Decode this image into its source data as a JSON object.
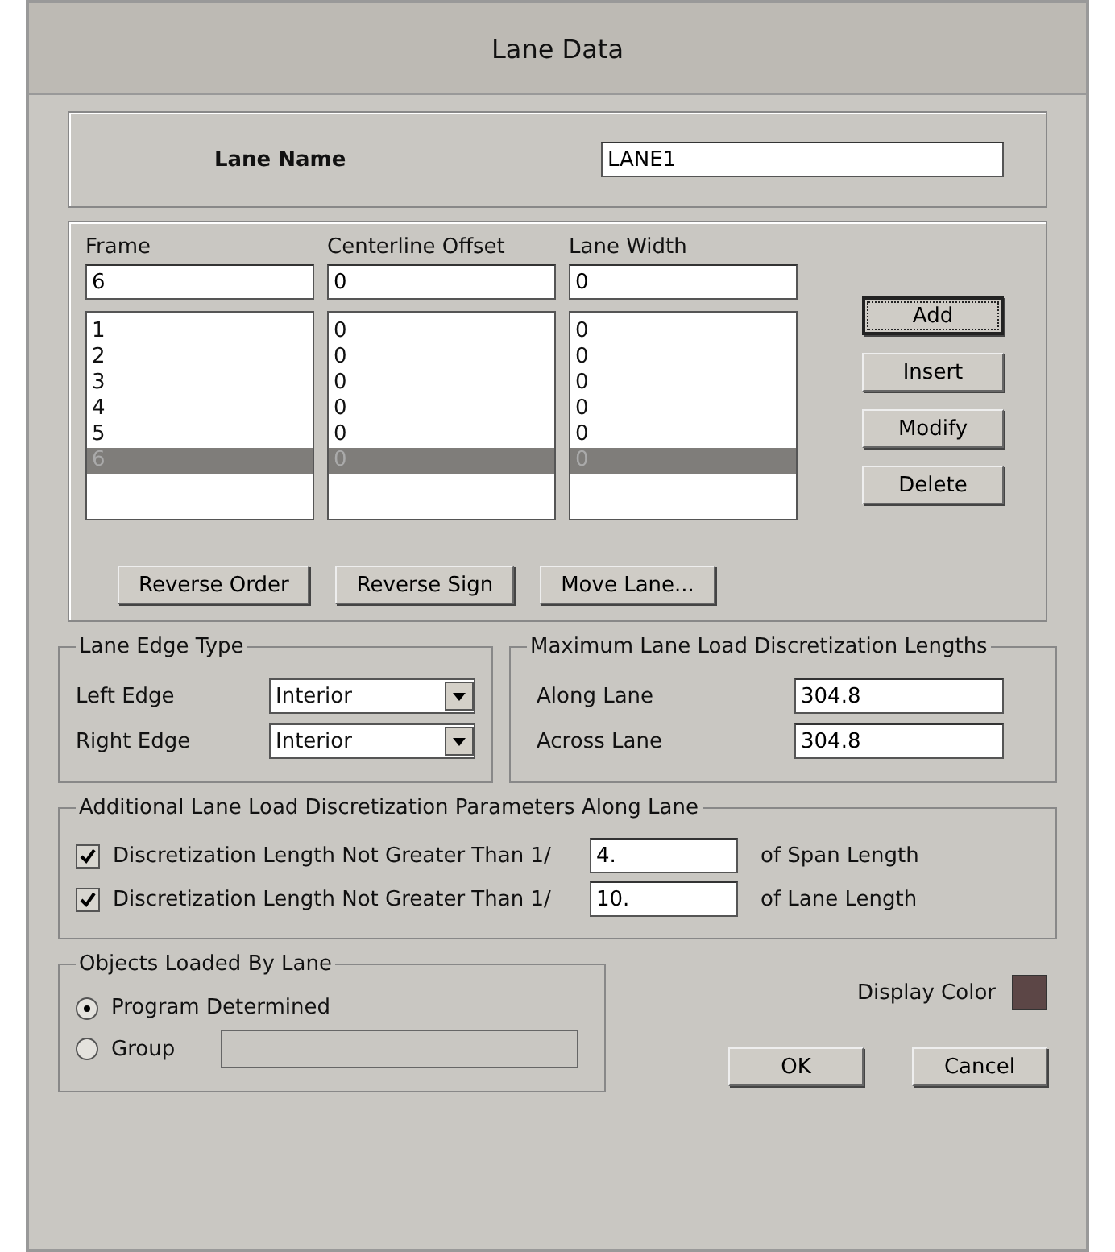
{
  "window": {
    "title": "Lane Data"
  },
  "lane_name": {
    "label": "Lane Name",
    "value": "LANE1"
  },
  "columns": [
    {
      "heading": "Frame",
      "entry": "6"
    },
    {
      "heading": "Centerline Offset",
      "entry": "0"
    },
    {
      "heading": "Lane Width",
      "entry": "0"
    }
  ],
  "rows": [
    {
      "cells": [
        "1",
        "0",
        "0"
      ],
      "selected": false
    },
    {
      "cells": [
        "2",
        "0",
        "0"
      ],
      "selected": false
    },
    {
      "cells": [
        "3",
        "0",
        "0"
      ],
      "selected": false
    },
    {
      "cells": [
        "4",
        "0",
        "0"
      ],
      "selected": false
    },
    {
      "cells": [
        "5",
        "0",
        "0"
      ],
      "selected": false
    },
    {
      "cells": [
        "6",
        "0",
        "0"
      ],
      "selected": true
    }
  ],
  "side_buttons": [
    {
      "label": "Add",
      "focused": true
    },
    {
      "label": "Insert",
      "focused": false
    },
    {
      "label": "Modify",
      "focused": false
    },
    {
      "label": "Delete",
      "focused": false
    }
  ],
  "list_buttons": [
    "Reverse Order",
    "Reverse Sign",
    "Move Lane..."
  ],
  "edge_type": {
    "title": "Lane Edge Type",
    "fields": [
      {
        "label": "Left Edge",
        "value": "Interior"
      },
      {
        "label": "Right Edge",
        "value": "Interior"
      }
    ]
  },
  "max_lengths": {
    "title": "Maximum Lane Load Discretization Lengths",
    "fields": [
      {
        "label": "Along Lane",
        "value": "304.8"
      },
      {
        "label": "Across Lane",
        "value": "304.8"
      }
    ]
  },
  "additional": {
    "title": "Additional Lane Load Discretization Parameters Along Lane",
    "items": [
      {
        "label": "Discretization Length Not Greater Than  1/",
        "checked": true,
        "value": "4.",
        "suffix": "of Span Length"
      },
      {
        "label": "Discretization Length Not Greater Than  1/",
        "checked": true,
        "value": "10.",
        "suffix": "of Lane Length"
      }
    ]
  },
  "objects": {
    "title": "Objects Loaded By Lane",
    "options": [
      {
        "label": "Program Determined",
        "selected": true
      },
      {
        "label": "Group",
        "selected": false
      }
    ]
  },
  "display_color": {
    "label": "Display Color",
    "color": "#5c4646"
  },
  "buttons": [
    "OK",
    "Cancel"
  ]
}
